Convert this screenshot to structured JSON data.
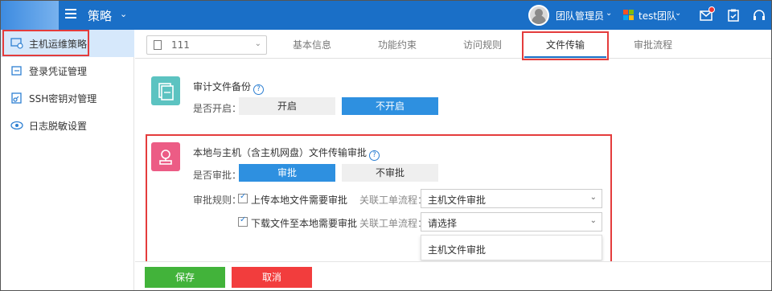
{
  "header": {
    "app_title": "策略",
    "user_name": "团队管理员",
    "team_name": "test团队"
  },
  "sidebar": {
    "items": [
      {
        "label": "主机运维策略",
        "icon": "host-policy-icon"
      },
      {
        "label": "登录凭证管理",
        "icon": "credential-icon"
      },
      {
        "label": "SSH密钥对管理",
        "icon": "key-icon"
      },
      {
        "label": "日志脱敏设置",
        "icon": "eye-icon"
      }
    ]
  },
  "tabs": {
    "selector_value": "111",
    "items": [
      "基本信息",
      "功能约束",
      "访问规则",
      "文件传输",
      "审批流程"
    ],
    "active": "文件传输"
  },
  "audit_backup": {
    "title": "审计文件备份",
    "enable_label": "是否开启：",
    "on_label": "开启",
    "off_label": "不开启",
    "selected": "不开启"
  },
  "transfer_approval": {
    "title": "本地与主机（含主机网盘）文件传输审批",
    "approve_label": "是否审批：",
    "approve_on": "审批",
    "approve_off": "不审批",
    "selected": "审批",
    "rules_label": "审批规则：",
    "rule1": "上传本地文件需要审批",
    "rule2": "下载文件至本地需要审批",
    "flow_label": "关联工单流程：",
    "select1_value": "主机文件审批",
    "select2_value": "请选择",
    "dropdown_option": "主机文件审批"
  },
  "footer": {
    "save_label": "保存",
    "cancel_label": "取消"
  },
  "colors": {
    "topbar": "#1a6fc7",
    "primary_button": "#2e90e0",
    "save_button": "#42b33a",
    "cancel_button": "#f23d3d",
    "highlight_box": "#e43c3c"
  }
}
